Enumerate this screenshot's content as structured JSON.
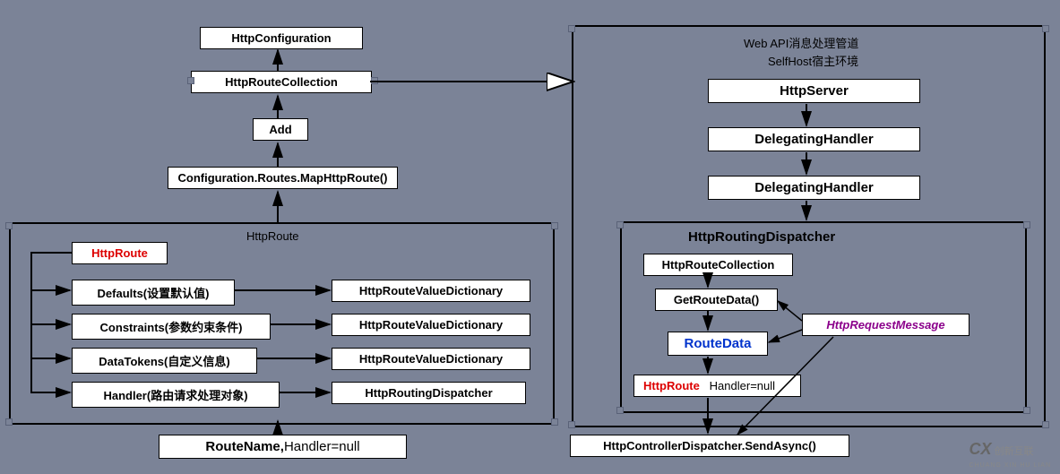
{
  "left": {
    "httpConfiguration": "HttpConfiguration",
    "httpRouteCollection": "HttpRouteCollection",
    "add": "Add",
    "mapRoute": "Configuration.Routes.MapHttpRoute()",
    "httpRouteTitle": "HttpRoute",
    "rows": [
      {
        "label": "HttpRoute",
        "color": "#d00"
      },
      {
        "label": "Defaults(设置默认值)",
        "target": "HttpRouteValueDictionary"
      },
      {
        "label": "Constraints(参数约束条件)",
        "target": "HttpRouteValueDictionary"
      },
      {
        "label": "DataTokens(自定义信息)",
        "target": "HttpRouteValueDictionary"
      },
      {
        "label": "Handler(路由请求处理对象)",
        "target": "HttpRoutingDispatcher"
      }
    ],
    "routeName": "RouteName,",
    "handlerNull": "Handler=null"
  },
  "right": {
    "title1": "Web API消息处理管道",
    "title2": "SelfHost宿主环境",
    "httpServer": "HttpServer",
    "dh1": "DelegatingHandler",
    "dh2": "DelegatingHandler",
    "dispatcher": "HttpRoutingDispatcher",
    "httpRouteCollection": "HttpRouteCollection",
    "getRouteData": "GetRouteData()",
    "routeData": "RouteData",
    "httpRoute": "HttpRoute",
    "handlerNull": "Handler=null",
    "httpRequestMessage": "HttpRequestMessage",
    "sendAsync": "HttpControllerDispatcher.SendAsync()"
  },
  "watermark": {
    "logo": "CX",
    "text": "创新互联",
    "sub": "CHUANG XIN HU LIAN"
  }
}
